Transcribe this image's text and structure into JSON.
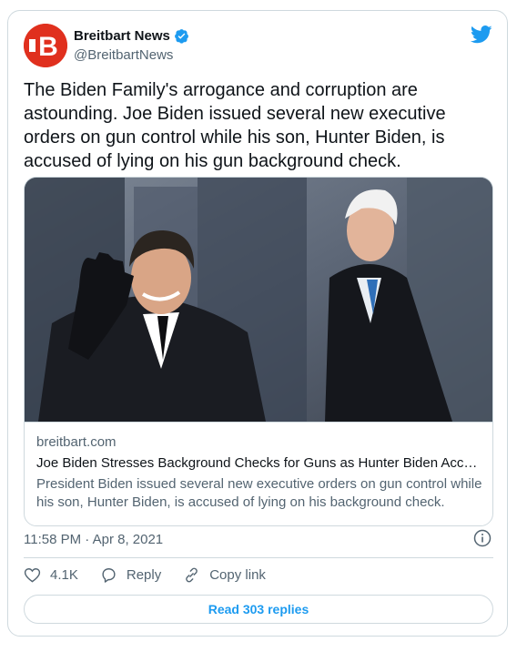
{
  "author": {
    "display_name": "Breitbart News",
    "handle": "@BreitbartNews",
    "verified": true,
    "avatar_icon": "breitbart-b-logo",
    "avatar_letter": "B",
    "avatar_color": "#e0301e"
  },
  "tweet": {
    "text": "The Biden Family's arrogance and corruption are astounding. Joe Biden issued several new executive orders on gun control while his son, Hunter Biden, is accused of lying on his gun background check."
  },
  "link_card": {
    "domain": "breitbart.com",
    "title": "Joe Biden Stresses Background Checks for Guns as Hunter Biden Accused…",
    "description": "President Biden issued several new executive orders on gun control while his son, Hunter Biden, is accused of lying on his background check."
  },
  "meta": {
    "timestamp": "11:58 PM · Apr 8, 2021"
  },
  "actions": {
    "like_count": "4.1K",
    "reply_label": "Reply",
    "copy_label": "Copy link"
  },
  "footer": {
    "read_replies_label": "Read 303 replies"
  },
  "colors": {
    "accent": "#1d9bf0",
    "muted": "#536471",
    "border": "#cfd9de"
  }
}
